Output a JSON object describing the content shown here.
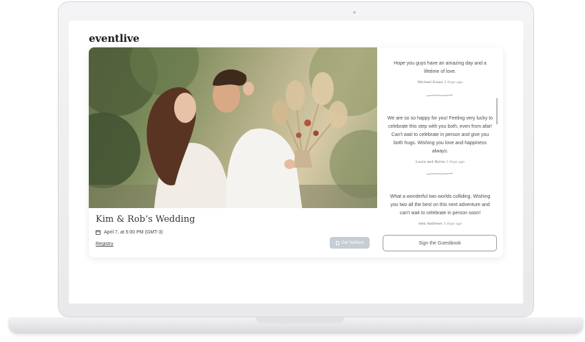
{
  "app": {
    "logo_text": "eventlive"
  },
  "event": {
    "title": "Kim & Rob’s Wedding",
    "date": "April 7, at 5:00 PM (GMT-3)",
    "registry_label": "Registry",
    "notify_label": "Get Notified"
  },
  "guestbook": {
    "entries": [
      {
        "text": "Hope you guys have an amazing day and a lifetime of love.",
        "author": "Michael Evans",
        "age": "2 days ago"
      },
      {
        "text": "We are so so happy for you! Feeling very lucky to celebrate this step with you both, even from afar! Can't wait to celebrate in person and give you both hugs. Wishing you love and happiness always.",
        "author": "Laura and Byron",
        "age": "3 days ago"
      },
      {
        "text": "What a wonderful two worlds colliding. Wishing you two all the best on this next adventure and can't wait to celebrate in person soon!",
        "author": "Alex Andrews",
        "age": "3 days ago"
      }
    ],
    "sign_label": "Sign the Guestbook"
  },
  "icons": {
    "calendar": "calendar-icon",
    "bell": "bell-icon"
  }
}
